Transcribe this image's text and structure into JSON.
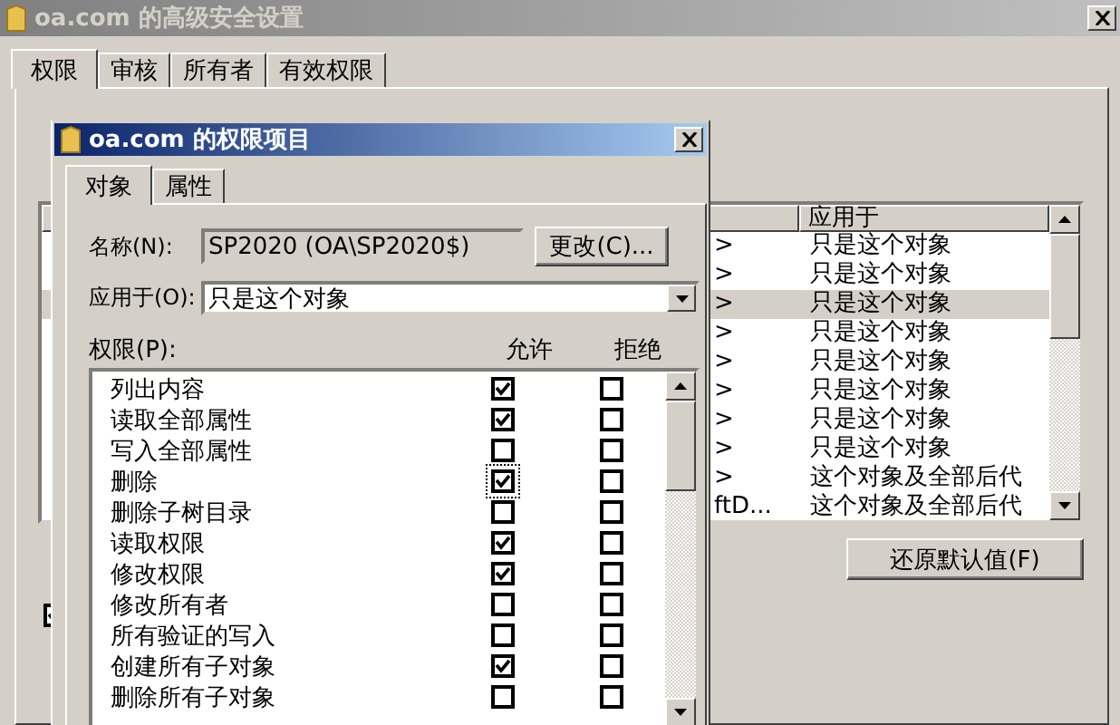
{
  "window": {
    "title": "oa.com 的高级安全设置"
  },
  "tabs": [
    {
      "label": "权限",
      "selected": true
    },
    {
      "label": "审核",
      "selected": false
    },
    {
      "label": "所有者",
      "selected": false
    },
    {
      "label": "有效权限",
      "selected": false
    }
  ],
  "entries": {
    "columns": [
      "应用于"
    ],
    "rows": [
      {
        "column_1": ">",
        "applies_to": "只是这个对象",
        "selected": false
      },
      {
        "column_1": ">",
        "applies_to": "只是这个对象",
        "selected": false
      },
      {
        "column_1": ">",
        "applies_to": "只是这个对象",
        "selected": true
      },
      {
        "column_1": ">",
        "applies_to": "只是这个对象",
        "selected": false
      },
      {
        "column_1": ">",
        "applies_to": "只是这个对象",
        "selected": false
      },
      {
        "column_1": ">",
        "applies_to": "只是这个对象",
        "selected": false
      },
      {
        "column_1": ">",
        "applies_to": "只是这个对象",
        "selected": false
      },
      {
        "column_1": ">",
        "applies_to": "只是这个对象",
        "selected": false
      },
      {
        "column_1": ">",
        "applies_to": "这个对象及全部后代",
        "selected": false
      },
      {
        "column_1": "ftD...",
        "applies_to": "这个对象及全部后代",
        "selected": false
      }
    ]
  },
  "restore_button": "还原默认值(F)",
  "inherit_checkbox": {
    "checked": true
  },
  "dialog": {
    "title": "oa.com 的权限项目",
    "tabs": [
      {
        "label": "对象",
        "selected": true
      },
      {
        "label": "属性",
        "selected": false
      }
    ],
    "name_label": "名称(N):",
    "name_value": "SP2020 (OA\\SP2020$)",
    "change_button": "更改(C)...",
    "apply_label": "应用于(O):",
    "apply_value": "只是这个对象",
    "permissions_label": "权限(P):",
    "allow_header": "允许",
    "deny_header": "拒绝",
    "permissions": [
      {
        "name": "列出内容",
        "allow": true,
        "deny": false,
        "focused": false
      },
      {
        "name": "读取全部属性",
        "allow": true,
        "deny": false,
        "focused": false
      },
      {
        "name": "写入全部属性",
        "allow": false,
        "deny": false,
        "focused": false
      },
      {
        "name": "删除",
        "allow": true,
        "deny": false,
        "focused": true
      },
      {
        "name": "删除子树目录",
        "allow": false,
        "deny": false,
        "focused": false
      },
      {
        "name": "读取权限",
        "allow": true,
        "deny": false,
        "focused": false
      },
      {
        "name": "修改权限",
        "allow": true,
        "deny": false,
        "focused": false
      },
      {
        "name": "修改所有者",
        "allow": false,
        "deny": false,
        "focused": false
      },
      {
        "name": "所有验证的写入",
        "allow": false,
        "deny": false,
        "focused": false
      },
      {
        "name": "创建所有子对象",
        "allow": true,
        "deny": false,
        "focused": false
      },
      {
        "name": "删除所有子对象",
        "allow": false,
        "deny": false,
        "focused": false
      }
    ]
  }
}
